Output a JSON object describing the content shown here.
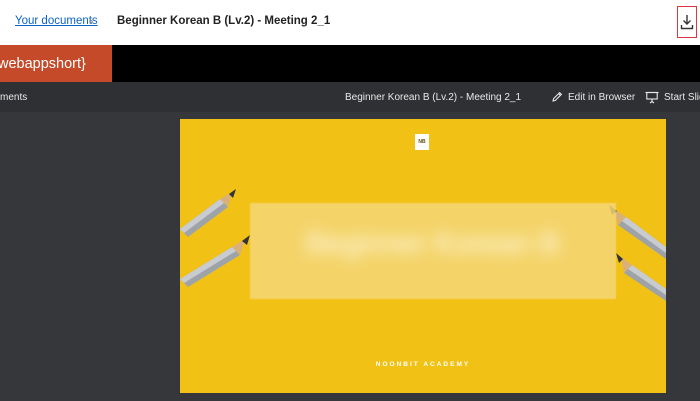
{
  "breadcrumb": {
    "parent_label": "Your documents",
    "separator": "›",
    "current_label": "Beginner Korean B (Lv.2) - Meeting 2_1"
  },
  "download": {
    "icon": "download-icon",
    "highlight_color": "#e0343e"
  },
  "appbar": {
    "brand_label": "webappshort}",
    "brand_color": "#c44a2a"
  },
  "viewer_toolbar": {
    "left_label": "ments",
    "title": "Beginner Korean B (Lv.2) - Meeting 2_1",
    "edit_label": "Edit in Browser",
    "edit_icon": "pencil-icon",
    "start_label": "Start Slid",
    "start_icon": "presentation-icon"
  },
  "slide": {
    "background_color": "#f2c116",
    "logo_text": "NB",
    "headline": "Beginner Korean B",
    "footer": "NOONBIT ACADEMY"
  }
}
